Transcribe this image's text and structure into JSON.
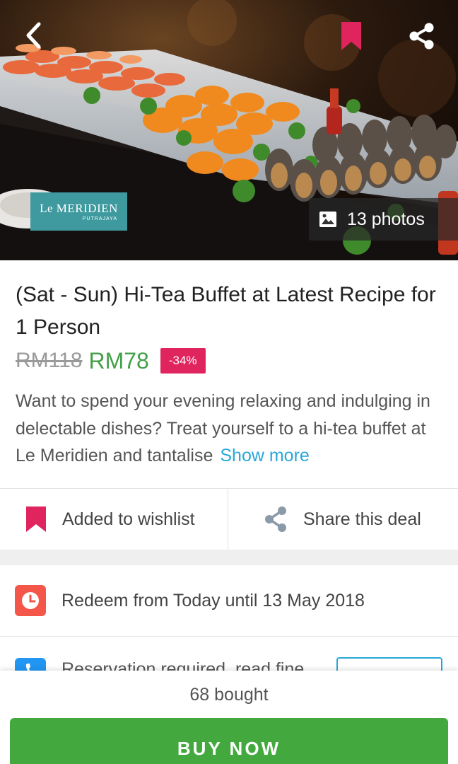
{
  "hero": {
    "photos_count_label": "13 photos",
    "logo_text": "Le MERIDIEN",
    "logo_subtext": "PUTRAJAYA",
    "icons": {
      "back": "chevron-left-icon",
      "bookmark": "bookmark-icon",
      "share": "share-icon",
      "photos": "image-icon"
    },
    "bookmark_color": "#e0245e"
  },
  "deal": {
    "title": "(Sat - Sun) Hi-Tea Buffet at Latest Recipe for 1 Person",
    "original_price": "RM118",
    "price": "RM78",
    "discount": "-34%",
    "description": "Want to spend your evening relaxing and indulging in delectable dishes? Treat yourself to a hi-tea buffet at Le Meridien and tantalise",
    "show_more": "Show more"
  },
  "actions": {
    "wishlist_label": "Added to wishlist",
    "share_label": "Share this deal"
  },
  "info": {
    "redeem_text": "Redeem from Today until 13 May 2018",
    "reservation_text": "Reservation required, read fine"
  },
  "footer": {
    "bought_label": "68 bought",
    "buy_label": "BUY NOW"
  },
  "colors": {
    "accent_green": "#43a93f",
    "price_green": "#43a047",
    "discount_pink": "#e0245e",
    "link_blue": "#29a8d8",
    "clock_red": "#f4574a"
  }
}
